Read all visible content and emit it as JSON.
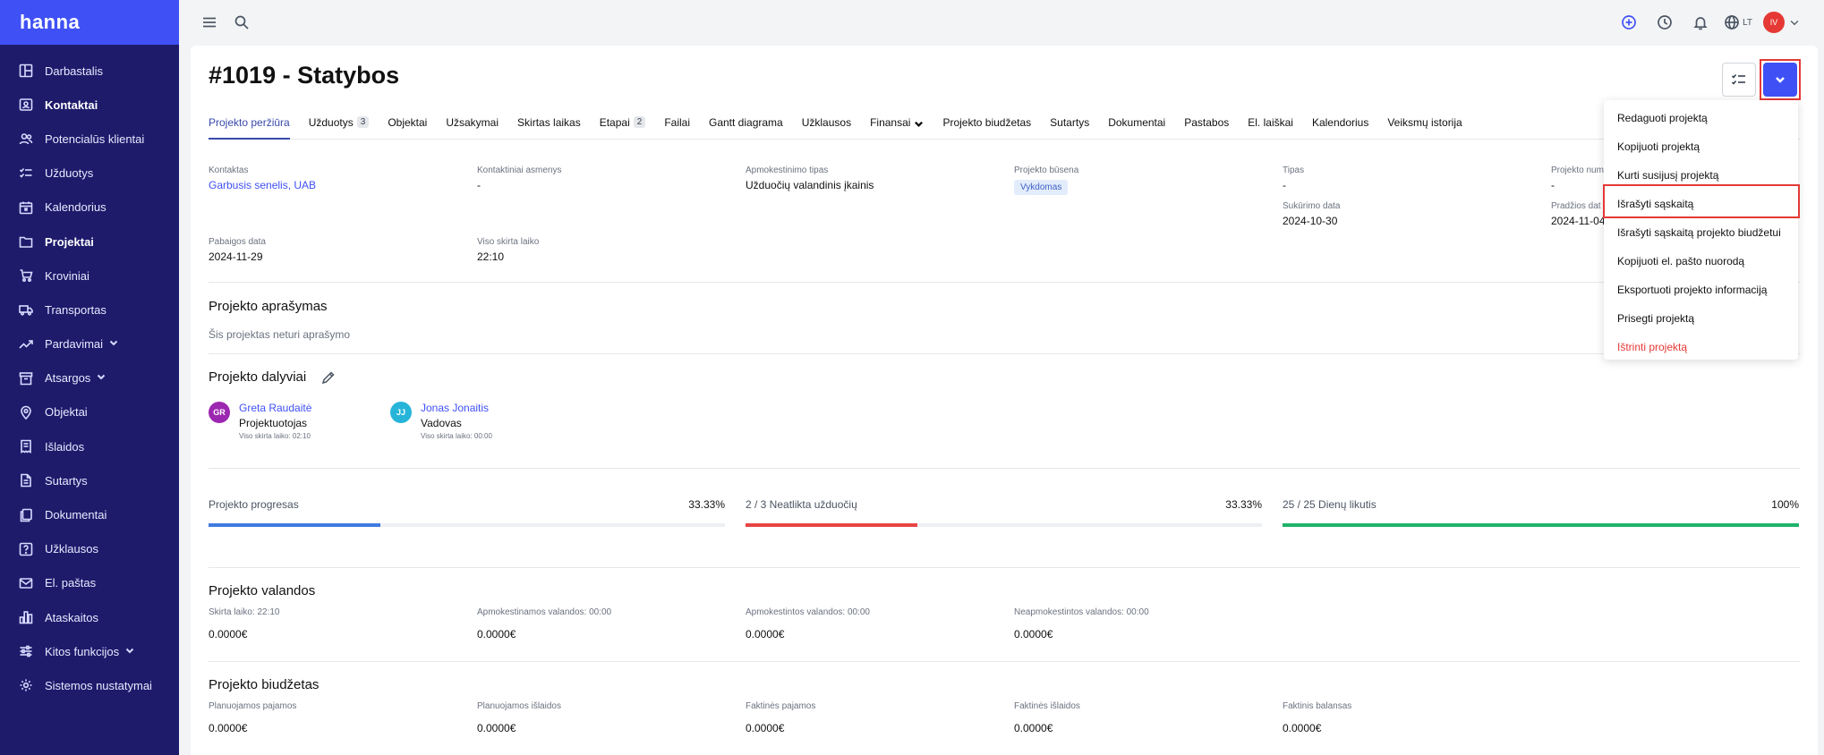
{
  "app": {
    "logo": "hanna"
  },
  "sidebar": {
    "items": [
      {
        "label": "Darbastalis",
        "icon": "dashboard-icon"
      },
      {
        "label": "Kontaktai",
        "icon": "contacts-icon"
      },
      {
        "label": "Potencialūs klientai",
        "icon": "users-icon"
      },
      {
        "label": "Užduotys",
        "icon": "tasks-icon"
      },
      {
        "label": "Kalendorius",
        "icon": "calendar-icon"
      },
      {
        "label": "Projektai",
        "icon": "folder-icon"
      },
      {
        "label": "Kroviniai",
        "icon": "cart-icon"
      },
      {
        "label": "Transportas",
        "icon": "truck-icon"
      },
      {
        "label": "Pardavimai",
        "icon": "trend-icon"
      },
      {
        "label": "Atsargos",
        "icon": "archive-icon"
      },
      {
        "label": "Objektai",
        "icon": "pin-icon"
      },
      {
        "label": "Išlaidos",
        "icon": "receipt-icon"
      },
      {
        "label": "Sutartys",
        "icon": "document-icon"
      },
      {
        "label": "Dokumentai",
        "icon": "files-icon"
      },
      {
        "label": "Užklausos",
        "icon": "question-icon"
      },
      {
        "label": "El. paštas",
        "icon": "mail-icon"
      },
      {
        "label": "Ataskaitos",
        "icon": "chart-icon"
      },
      {
        "label": "Kitos funkcijos",
        "icon": "sliders-icon"
      },
      {
        "label": "Sistemos nustatymai",
        "icon": "gear-icon"
      }
    ]
  },
  "topbar": {
    "lang": "LT",
    "avatar": "IV"
  },
  "project": {
    "title": "#1019 - Statybos",
    "tabs": [
      {
        "label": "Projekto peržiūra"
      },
      {
        "label": "Užduotys",
        "badge": "3"
      },
      {
        "label": "Objektai"
      },
      {
        "label": "Užsakymai"
      },
      {
        "label": "Skirtas laikas"
      },
      {
        "label": "Etapai",
        "badge": "2"
      },
      {
        "label": "Failai"
      },
      {
        "label": "Gantt diagrama"
      },
      {
        "label": "Užklausos"
      },
      {
        "label": "Finansai"
      },
      {
        "label": "Projekto biudžetas"
      },
      {
        "label": "Sutartys"
      },
      {
        "label": "Dokumentai"
      },
      {
        "label": "Pastabos"
      },
      {
        "label": "El. laiškai"
      },
      {
        "label": "Kalendorius"
      },
      {
        "label": "Veiksmų istorija"
      }
    ],
    "info": {
      "contact_label": "Kontaktas",
      "contact_value": "Garbusis senelis, UAB",
      "contact_persons_label": "Kontaktiniai asmenys",
      "contact_persons_value": "-",
      "billing_type_label": "Apmokestinimo tipas",
      "billing_type_value": "Užduočių valandinis įkainis",
      "status_label": "Projekto būsena",
      "status_value": "Vykdomas",
      "type_label": "Tipas",
      "type_value": "-",
      "number_label": "Projekto num",
      "number_value": "-",
      "created_label": "Sukūrimo data",
      "created_value": "2024-10-30",
      "start_label": "Pradžios dat",
      "start_value": "2024-11-04",
      "end_label": "Pabaigos data",
      "end_value": "2024-11-29",
      "total_time_label": "Viso skirta laiko",
      "total_time_value": "22:10"
    },
    "description": {
      "title": "Projekto aprašymas",
      "empty_text": "Šis projektas neturi aprašymo"
    },
    "participants": {
      "title": "Projekto dalyviai",
      "list": [
        {
          "initials": "GR",
          "name": "Greta Raudaitė",
          "role": "Projektuotojas",
          "time": "Viso skirta laiko: 02:10",
          "color": "#9c27b0"
        },
        {
          "initials": "JJ",
          "name": "Jonas Jonaitis",
          "role": "Vadovas",
          "time": "Viso skirta laiko: 00:00",
          "color": "#26b5d9"
        }
      ]
    },
    "progress": [
      {
        "label": "Projekto progresas",
        "pct_label": "33.33%",
        "value": 0.3333,
        "color": "#3f7be0"
      },
      {
        "label": "2 / 3 Neatlikta užduočių",
        "pct_label": "33.33%",
        "value": 0.3333,
        "color": "#ea4444"
      },
      {
        "label": "25 / 25 Dienų likutis",
        "pct_label": "100%",
        "value": 1.0,
        "color": "#1fb36b"
      }
    ],
    "hours": {
      "title": "Projekto valandos",
      "items": [
        {
          "label": "Skirta laiko: 22:10",
          "value": "0.0000€"
        },
        {
          "label": "Apmokestinamos valandos: 00:00",
          "value": "0.0000€"
        },
        {
          "label": "Apmokestintos valandos: 00:00",
          "value": "0.0000€"
        },
        {
          "label": "Neapmokestintos valandos: 00:00",
          "value": "0.0000€"
        }
      ]
    },
    "budget": {
      "title": "Projekto biudžetas",
      "items": [
        {
          "label": "Planuojamos pajamos",
          "value": "0.0000€"
        },
        {
          "label": "Planuojamos išlaidos",
          "value": "0.0000€"
        },
        {
          "label": "Faktinės pajamos",
          "value": "0.0000€"
        },
        {
          "label": "Faktinės išlaidos",
          "value": "0.0000€"
        },
        {
          "label": "Faktinis balansas",
          "value": "0.0000€"
        }
      ]
    }
  },
  "actions_menu": {
    "items": [
      {
        "label": "Redaguoti projektą"
      },
      {
        "label": "Kopijuoti projektą"
      },
      {
        "label": "Kurti susijusį projektą"
      },
      {
        "label": "Išrašyti sąskaitą"
      },
      {
        "label": "Išrašyti sąskaitą projekto biudžetui"
      },
      {
        "label": "Kopijuoti el. pašto nuorodą"
      },
      {
        "label": "Eksportuoti projekto informaciją"
      },
      {
        "label": "Prisegti projektą"
      },
      {
        "label": "Ištrinti projektą",
        "danger": true
      }
    ]
  },
  "colors": {
    "accent": "#3f51f5",
    "sidebar": "#1e1b6b",
    "highlight": "#e53935"
  }
}
